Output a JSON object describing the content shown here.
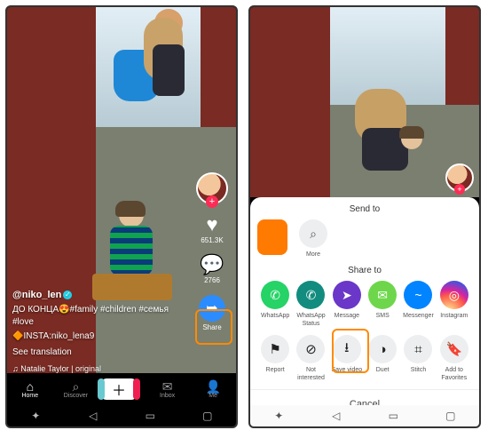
{
  "left": {
    "username": "@niko_len",
    "caption_line1": "ДО КОНЦА😍#family #children #семья #love",
    "caption_line2": "🔶INSTA:niko_lena9",
    "see_translation": "See translation",
    "music": "♫  Natalie Taylor | original",
    "actions": {
      "likes": "651.3K",
      "comments": "2766",
      "share": "Share"
    },
    "nav": {
      "home": "Home",
      "discover": "Discover",
      "inbox": "Inbox",
      "me": "Me"
    }
  },
  "right": {
    "send_to": "Send to",
    "more": "More",
    "share_to": "Share to",
    "share_targets": [
      {
        "name": "whatsapp",
        "label": "WhatsApp",
        "icon": "✆",
        "cls": "c-green"
      },
      {
        "name": "whatsapp-status",
        "label": "WhatsApp Status",
        "icon": "✆",
        "cls": "c-dgreen"
      },
      {
        "name": "message",
        "label": "Message",
        "icon": "➤",
        "cls": "c-purple"
      },
      {
        "name": "sms",
        "label": "SMS",
        "icon": "✉",
        "cls": "c-lgreen"
      },
      {
        "name": "messenger",
        "label": "Messenger",
        "icon": "~",
        "cls": "c-blue"
      },
      {
        "name": "instagram",
        "label": "Instagram",
        "icon": "◎",
        "cls": "c-ig"
      }
    ],
    "actions": [
      {
        "name": "report",
        "label": "Report",
        "icon": "⚑"
      },
      {
        "name": "not-interested",
        "label": "Not interested",
        "icon": "⊘"
      },
      {
        "name": "save-video",
        "label": "Save video",
        "icon": "⭳"
      },
      {
        "name": "duet",
        "label": "Duet",
        "icon": "◑"
      },
      {
        "name": "stitch",
        "label": "Stitch",
        "icon": "⌗"
      },
      {
        "name": "add-favorites",
        "label": "Add to Favorites",
        "icon": "🔖"
      }
    ],
    "cancel": "Cancel"
  },
  "softkeys": {
    "accessibility": "✦",
    "back": "◁",
    "home": "▭",
    "recent": "▢"
  }
}
